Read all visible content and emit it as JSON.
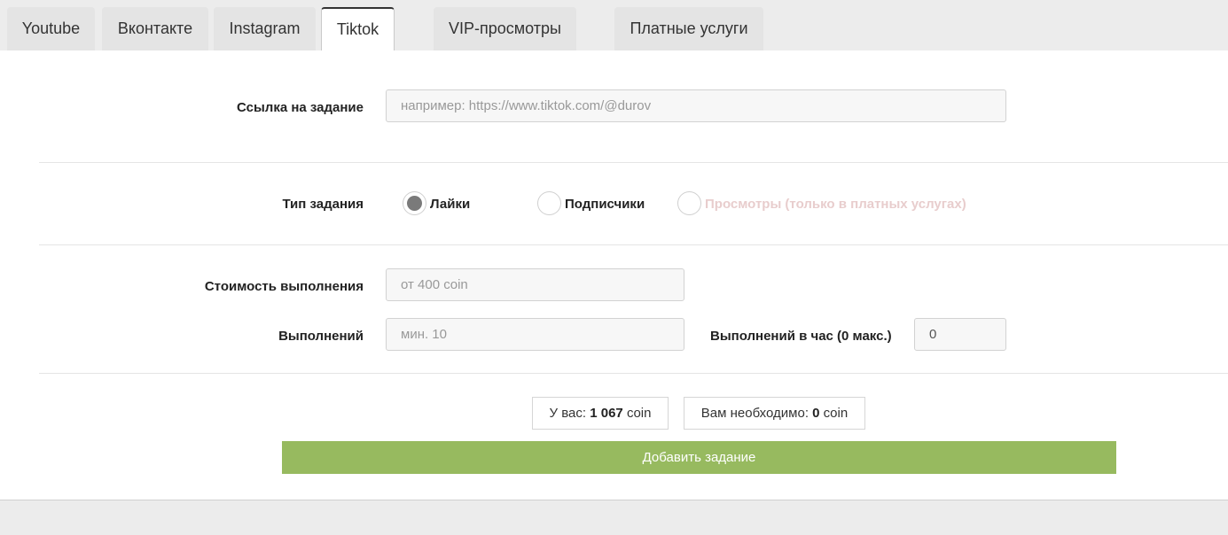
{
  "tabs": [
    {
      "label": "Youtube",
      "active": false
    },
    {
      "label": "Вконтакте",
      "active": false
    },
    {
      "label": "Instagram",
      "active": false
    },
    {
      "label": "Tiktok",
      "active": true
    },
    {
      "label": "VIP-просмотры",
      "active": false
    },
    {
      "label": "Платные услуги",
      "active": false
    }
  ],
  "form": {
    "link_label": "Ссылка на задание",
    "link_placeholder": "например: https://www.tiktok.com/@durov",
    "type_label": "Тип задания",
    "type_options": [
      {
        "label": "Лайки",
        "selected": true,
        "disabled": false
      },
      {
        "label": "Подписчики",
        "selected": false,
        "disabled": false
      },
      {
        "label": "Просмотры (только в платных услугах)",
        "selected": false,
        "disabled": true
      }
    ],
    "cost_label": "Стоимость выполнения",
    "cost_placeholder": "от 400 coin",
    "count_label": "Выполнений",
    "count_placeholder": "мин. 10",
    "per_hour_label": "Выполнений в час (0 макс.)",
    "per_hour_value": "0"
  },
  "balance": {
    "have_prefix": "У вас:",
    "have_amount": "1 067",
    "have_unit": "coin",
    "need_prefix": "Вам необходимо:",
    "need_amount": "0",
    "need_unit": "coin"
  },
  "submit_label": "Добавить задание",
  "colors": {
    "submit_bg": "#97ba5f",
    "disabled_text": "#e8cdcd",
    "selected_radio": "#7a7a7a"
  }
}
